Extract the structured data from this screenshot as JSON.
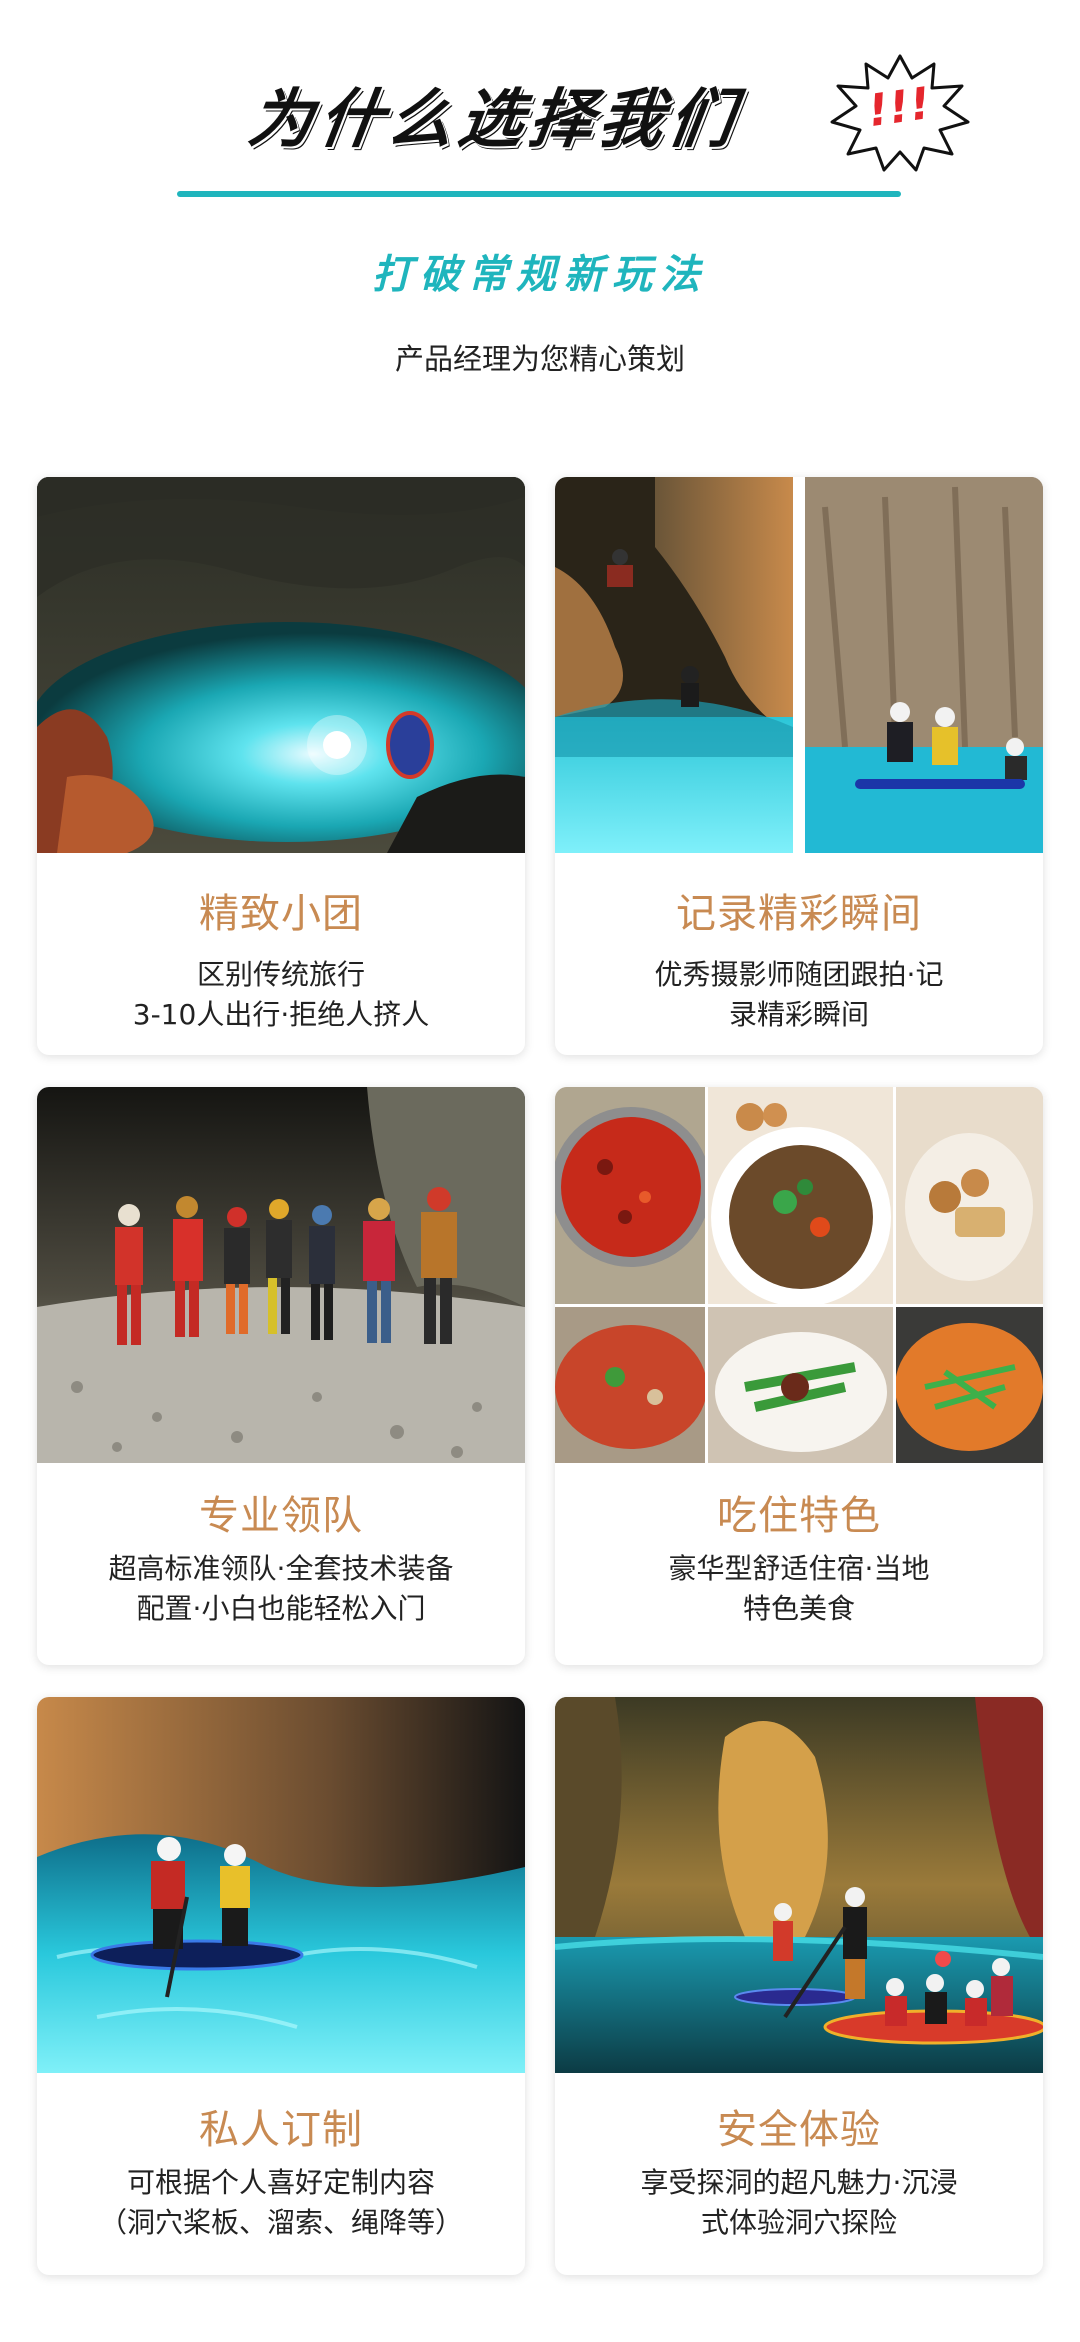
{
  "header": {
    "title": "为什么选择我们",
    "burst_text": "!!!",
    "subtitle": "打破常规新玩法",
    "tagline": "产品经理为您精心策划"
  },
  "colors": {
    "accent": "#1fb5bd",
    "card_title": "#c88a52",
    "burst_red": "#e5262d"
  },
  "cards": [
    {
      "title": "精致小团",
      "desc": [
        "区别传统旅行",
        "3-10人出行·拒绝人挤人"
      ],
      "image": "cave-turquoise-lake-paddleboard"
    },
    {
      "title": "记录精彩瞬间",
      "desc": [
        "优秀摄影师随团跟拍·记",
        "录精彩瞬间"
      ],
      "image": "cave-photographer-collage"
    },
    {
      "title": "专业领队",
      "desc": [
        "超高标准领队·全套技术装备",
        "配置·小白也能轻松入门"
      ],
      "image": "guide-team-group-photo"
    },
    {
      "title": "吃住特色",
      "desc": [
        "豪华型舒适住宿·当地",
        "特色美食"
      ],
      "image": "local-food-collage"
    },
    {
      "title": "私人订制",
      "desc": [
        "可根据个人喜好定制内容",
        "（洞穴桨板、溜索、绳降等）"
      ],
      "image": "cave-paddleboard-pair"
    },
    {
      "title": "安全体验",
      "desc": [
        "享受探洞的超凡魅力·沉浸",
        "式体验洞穴探险"
      ],
      "image": "cave-group-paddleboarding"
    }
  ]
}
